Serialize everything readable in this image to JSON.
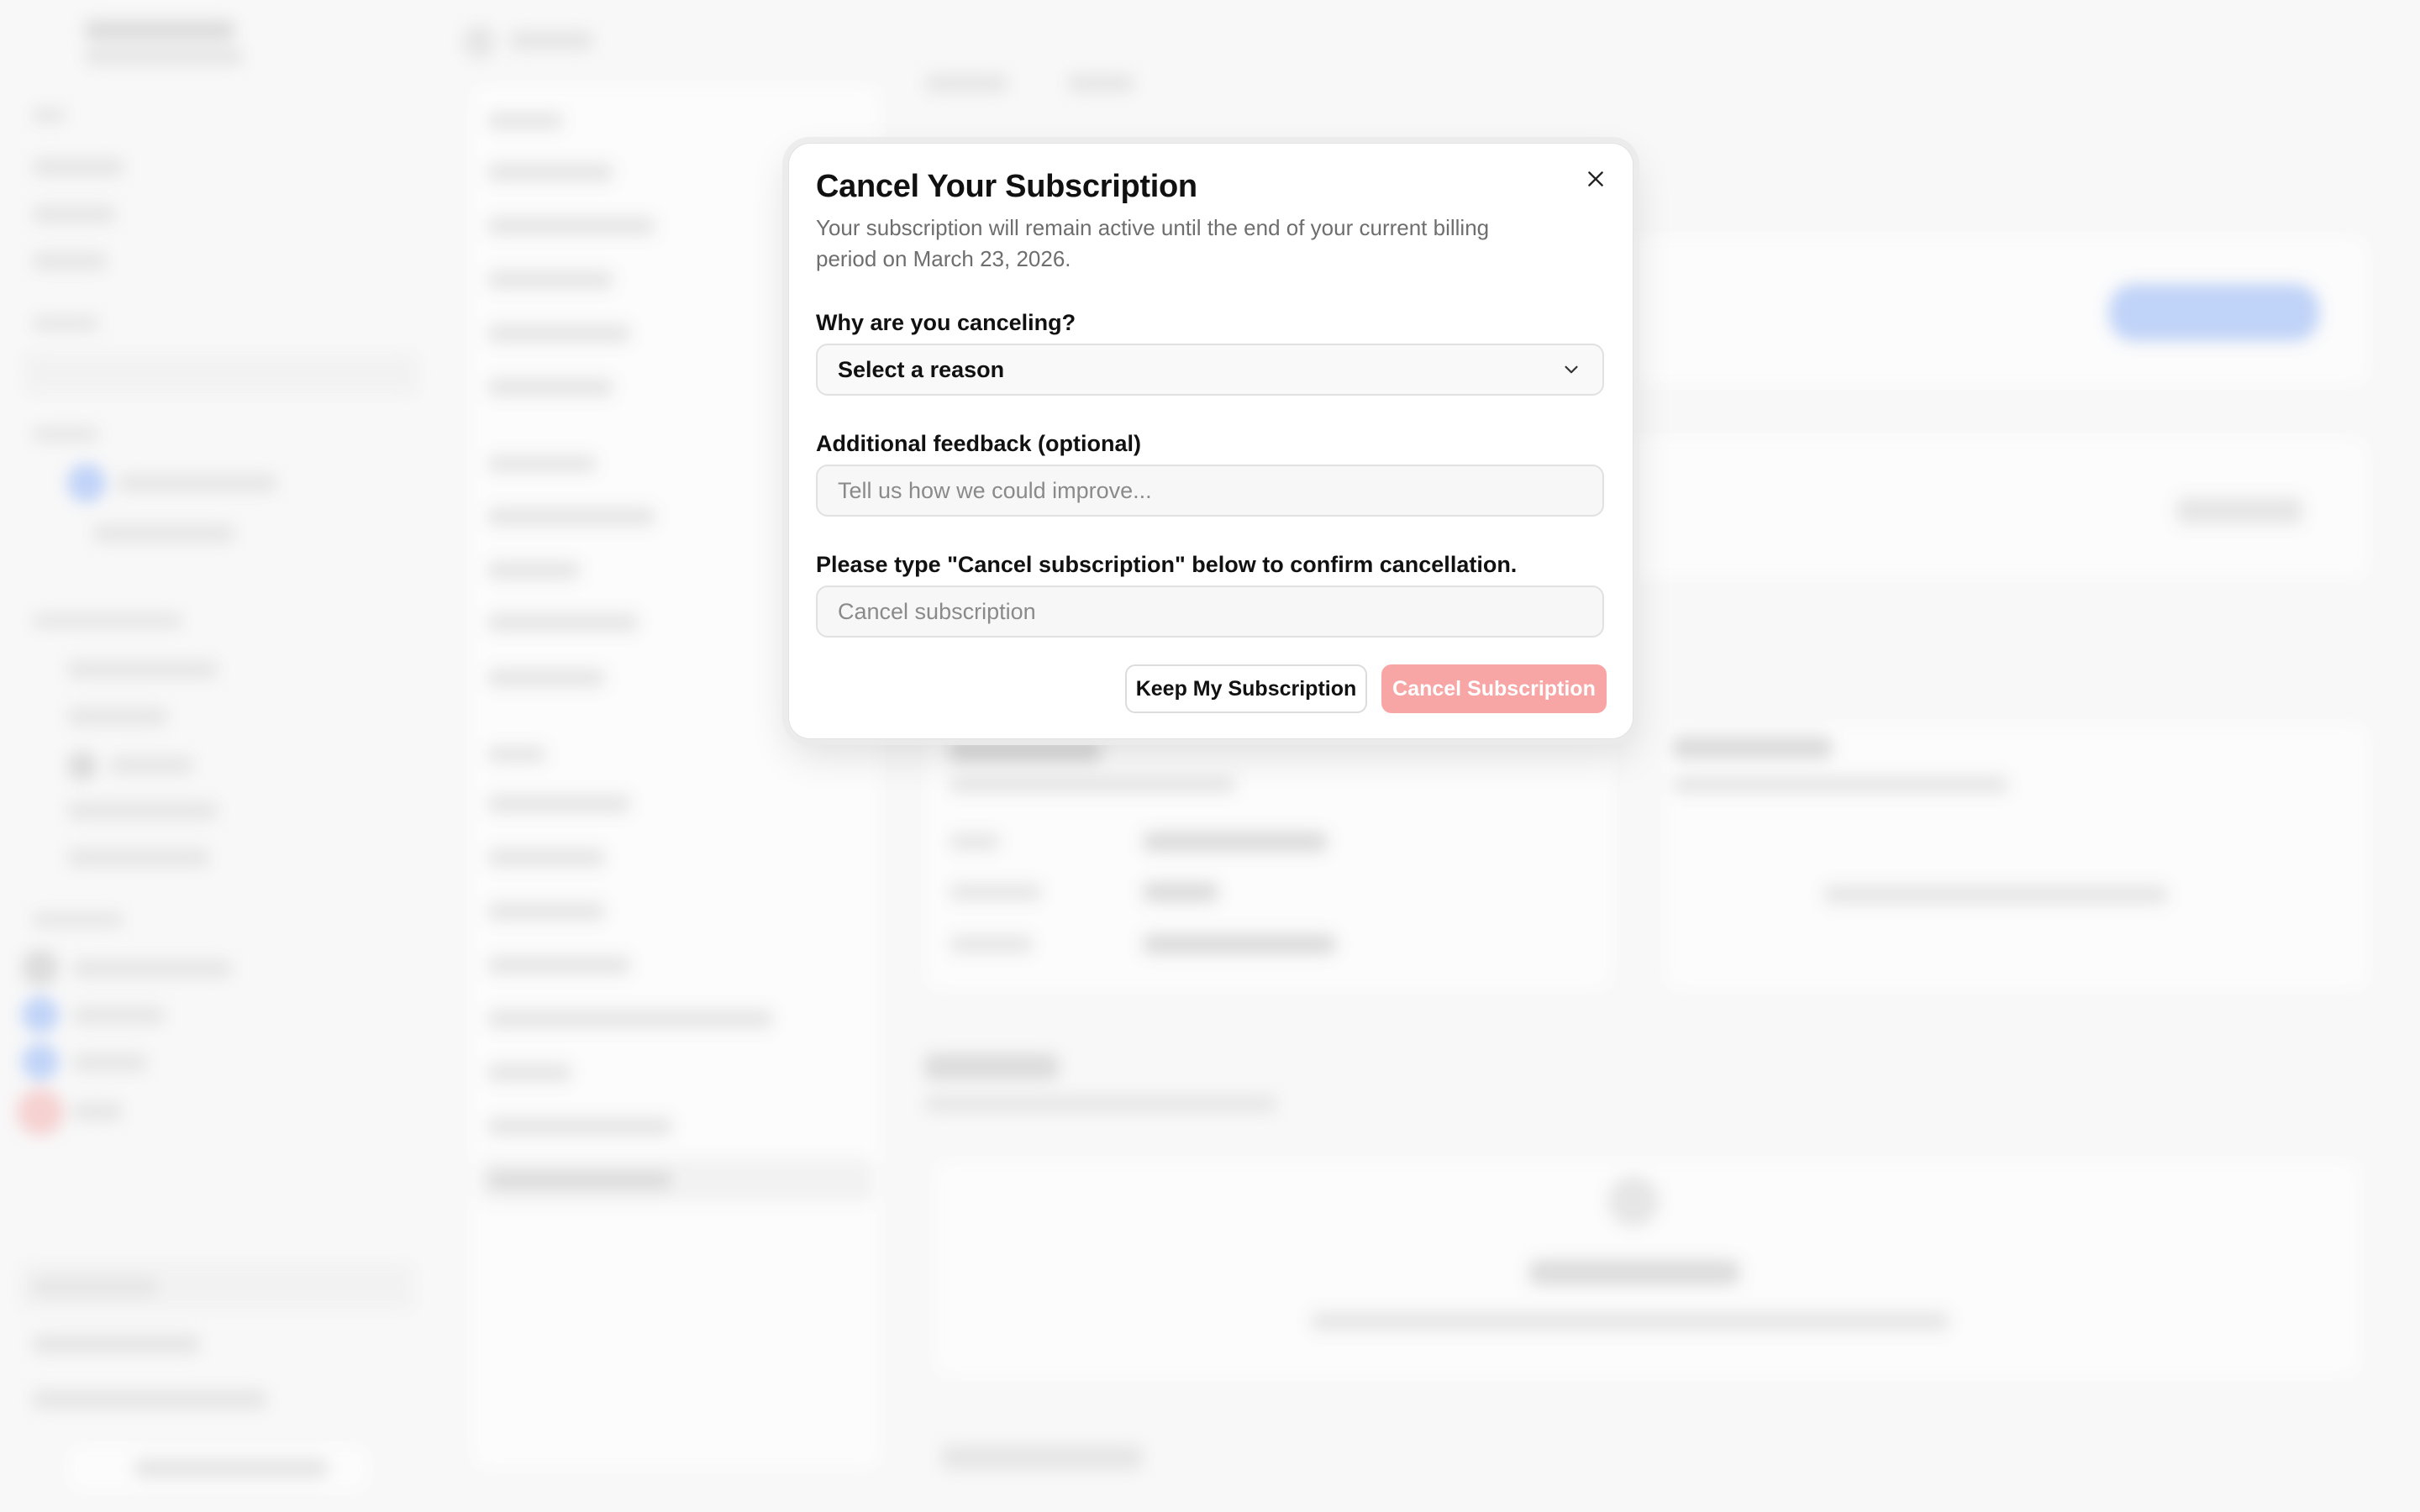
{
  "modal": {
    "title": "Cancel Your Subscription",
    "description": "Your subscription will remain active until the end of your current billing period on March 23, 2026.",
    "reason_label": "Why are you canceling?",
    "reason_selected": "Select a reason",
    "feedback_label": "Additional feedback (optional)",
    "feedback_placeholder": "Tell us how we could improve...",
    "confirm_label": "Please type \"Cancel subscription\" below to confirm cancellation.",
    "confirm_placeholder": "Cancel subscription",
    "keep_button": "Keep My Subscription",
    "cancel_button": "Cancel Subscription",
    "cancel_button_color": "#f7a5a5",
    "close_icon": "close-icon",
    "chevron_icon": "chevron-down-icon"
  }
}
